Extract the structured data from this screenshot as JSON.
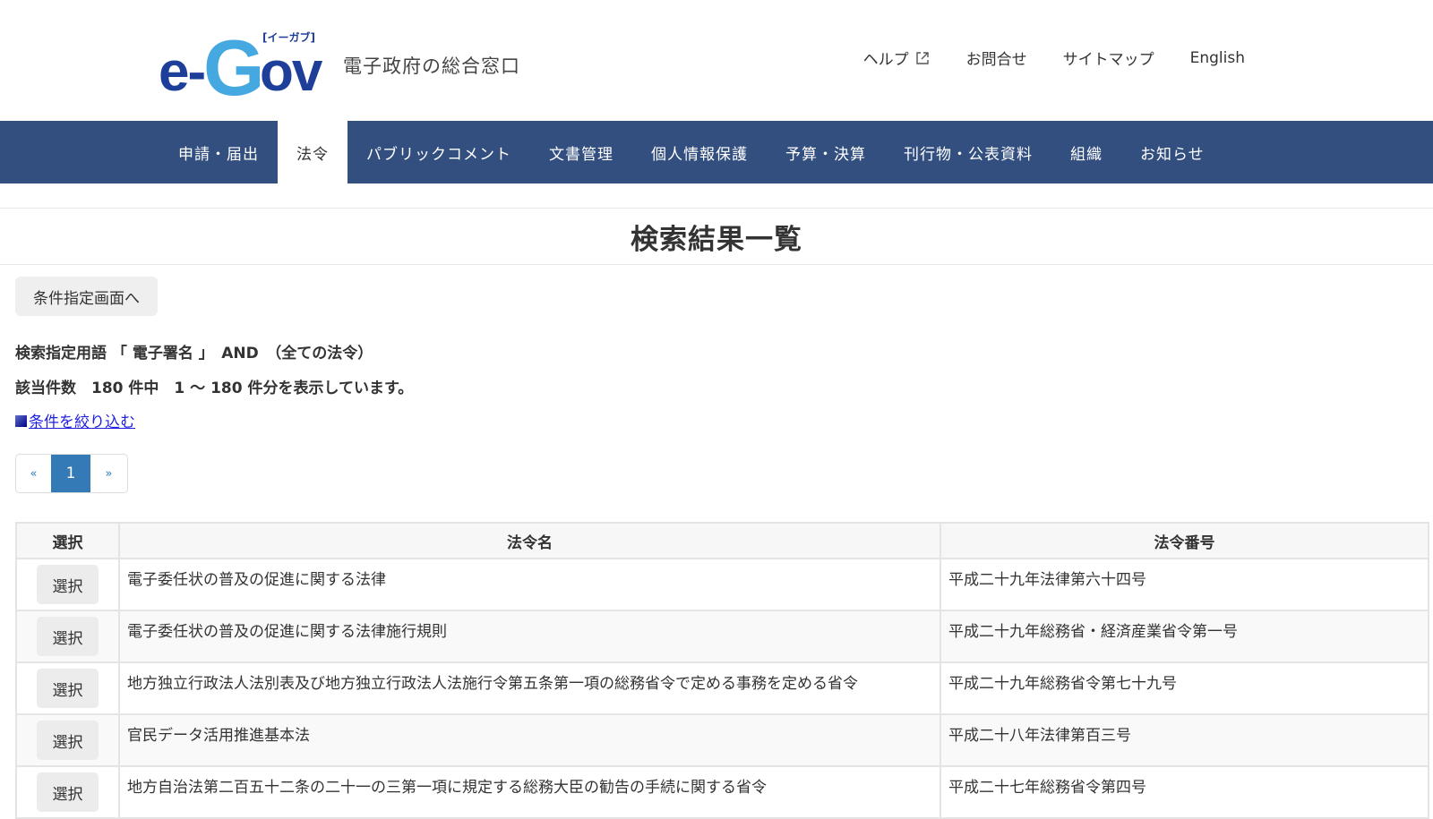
{
  "header": {
    "logo": {
      "brand_e": "e-",
      "brand_g": "G",
      "brand_ov": "ov",
      "kana": "[イーガブ]",
      "tagline": "電子政府の総合窓口"
    },
    "util_nav": [
      {
        "label": "ヘルプ",
        "icon": "external-link-icon"
      },
      {
        "label": "お問合せ"
      },
      {
        "label": "サイトマップ"
      },
      {
        "label": "English"
      }
    ]
  },
  "main_nav": {
    "items": [
      {
        "label": "申請・届出"
      },
      {
        "label": "法令",
        "active": true
      },
      {
        "label": "パブリックコメント"
      },
      {
        "label": "文書管理"
      },
      {
        "label": "個人情報保護"
      },
      {
        "label": "予算・決算"
      },
      {
        "label": "刊行物・公表資料"
      },
      {
        "label": "組織"
      },
      {
        "label": "お知らせ"
      }
    ]
  },
  "page": {
    "title": "検索結果一覧",
    "back_button": "条件指定画面へ",
    "search_terms": "検索指定用語 「 電子署名 」　AND　（全ての法令）",
    "result_count": "該当件数　180 件中　1 〜 180 件分を表示しています。",
    "refine_link": "条件を絞り込む"
  },
  "pagination": {
    "prev": "«",
    "current": "1",
    "next": "»"
  },
  "colors": {
    "nav_bg": "#334f7f",
    "page_active": "#337ab7",
    "link": "#1f1fe0"
  },
  "table": {
    "headers": {
      "select": "選択",
      "name": "法令名",
      "number": "法令番号"
    },
    "select_label": "選択",
    "rows": [
      {
        "name": "電子委任状の普及の促進に関する法律",
        "number": "平成二十九年法律第六十四号"
      },
      {
        "name": "電子委任状の普及の促進に関する法律施行規則",
        "number": "平成二十九年総務省・経済産業省令第一号"
      },
      {
        "name": "地方独立行政法人法別表及び地方独立行政法人法施行令第五条第一項の総務省令で定める事務を定める省令",
        "number": "平成二十九年総務省令第七十九号"
      },
      {
        "name": "官民データ活用推進基本法",
        "number": "平成二十八年法律第百三号"
      },
      {
        "name": "地方自治法第二百五十二条の二十一の三第一項に規定する総務大臣の勧告の手続に関する省令",
        "number": "平成二十七年総務省令第四号"
      }
    ]
  }
}
